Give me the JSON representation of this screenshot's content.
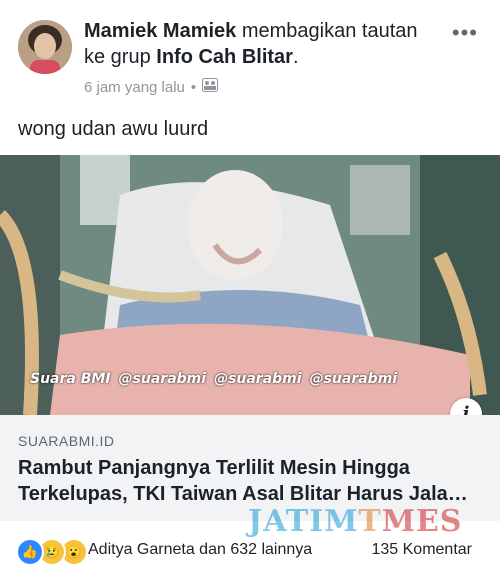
{
  "post": {
    "author": "Mamiek Mamiek",
    "action_text": "membagikan tautan ke grup",
    "group": "Info Cah Blitar",
    "time": "6 jam yang lalu",
    "body": "wong udan awu luurd"
  },
  "media": {
    "social_tags": [
      "Suara BMI",
      "@suarabmi",
      "@suarabmi",
      "@suarabmi"
    ]
  },
  "link": {
    "domain": "SUARABMI.ID",
    "title_line1": "Rambut Panjangnya Terlilit Mesin Hingga",
    "title_line2": "Terkelupas, TKI Taiwan Asal Blitar Harus Jala…"
  },
  "footer": {
    "reactions_text": "Aditya Garneta dan 632 lainnya",
    "comments_text": "135 Komentar"
  },
  "watermark": {
    "part1": "JATIM",
    "part2": "T",
    "part3": "MES"
  },
  "colors": {
    "link_bg": "#f2f3f5",
    "like_blue": "#2d88ff",
    "meta_gray": "#90949c"
  },
  "icons": [
    "more-icon",
    "group-privacy-icon",
    "info-icon",
    "like-reaction-icon",
    "sad-reaction-icon",
    "wow-reaction-icon"
  ]
}
